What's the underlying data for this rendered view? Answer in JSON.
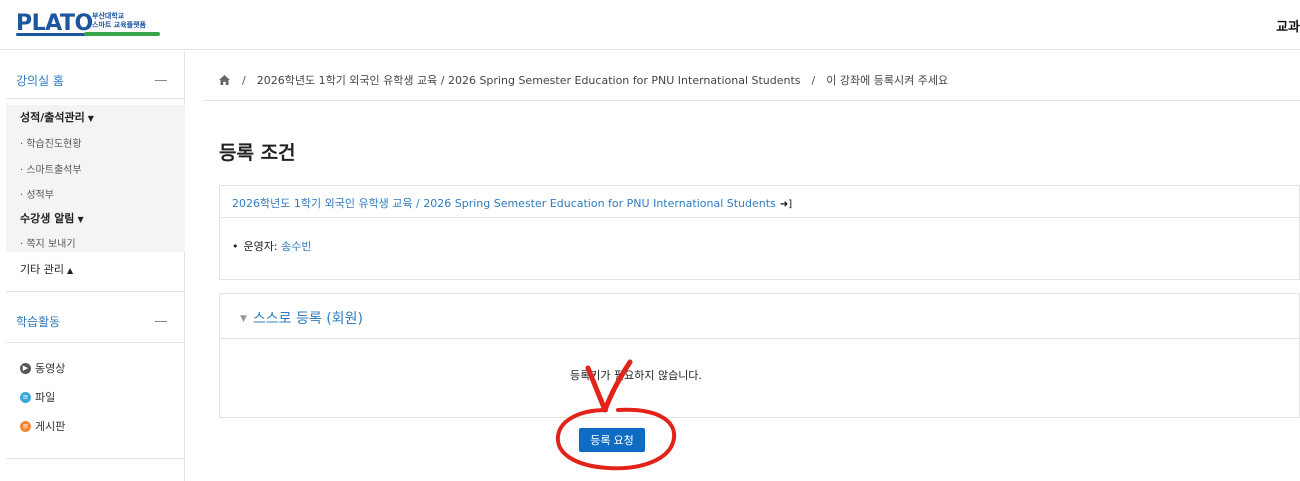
{
  "header": {
    "logo_main": "PLATO",
    "logo_sub": "부산대학교\n스마트 교육플랫폼",
    "right_text": "교과"
  },
  "sidebar": {
    "home_label": "강의실 홈",
    "groups": [
      {
        "label": "성적/출석관리",
        "items": [
          "학습진도현황",
          "스마트출석부",
          "성적부"
        ]
      },
      {
        "label": "수강생 알림",
        "items": [
          "쪽지 보내기"
        ]
      }
    ],
    "other_label": "기타 관리",
    "activity_title": "학습활동",
    "activities": [
      {
        "label": "동영상",
        "icon": "play-icon",
        "color": "#555555"
      },
      {
        "label": "파일",
        "icon": "file-icon",
        "color": "#3aa6d8"
      },
      {
        "label": "게시판",
        "icon": "board-icon",
        "color": "#f0883a"
      }
    ]
  },
  "breadcrumb": {
    "home_icon": "home-icon",
    "course": "2026학년도 1학기 외국인 유학생 교육 / 2026 Spring Semester Education for PNU International Students",
    "current": "이 강좌에 등록시켜 주세요"
  },
  "main": {
    "title": "등록 조건",
    "course_link": "2026학년도 1학기 외국인 유학생 교육 / 2026 Spring Semester Education for PNU International Students",
    "teacher_label": "운영자:",
    "teacher_name": "송수빈",
    "self_enrol_title": "스스로 등록 (회원)",
    "no_key_text": "등록키가 필요하지 않습니다.",
    "enroll_button": "등록 요청"
  },
  "colors": {
    "link": "#2f7bc0",
    "button": "#0f6cc4",
    "annotation": "#e2231a"
  }
}
